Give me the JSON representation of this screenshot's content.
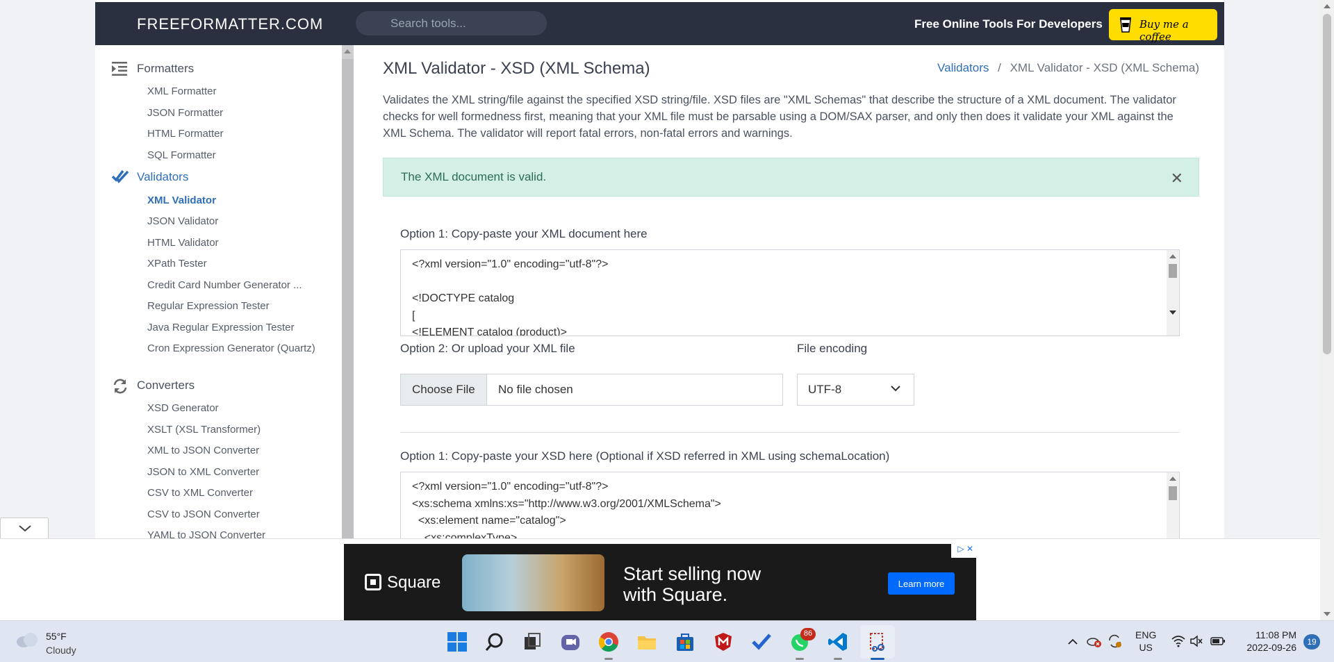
{
  "header": {
    "logo": "FREEFORMATTER.COM",
    "search_placeholder": "Search tools...",
    "tagline": "Free Online Tools For Developers",
    "coffee_label": "Buy me a coffee"
  },
  "sidebar": {
    "sections": [
      {
        "label": "Formatters",
        "icon": "indent-icon",
        "items": [
          "XML Formatter",
          "JSON Formatter",
          "HTML Formatter",
          "SQL Formatter"
        ]
      },
      {
        "label": "Validators",
        "icon": "checkmark-icon",
        "items": [
          "XML Validator",
          "JSON Validator",
          "HTML Validator",
          "XPath Tester",
          "Credit Card Number Generator ...",
          "Regular Expression Tester",
          "Java Regular Expression Tester",
          "Cron Expression Generator (Quartz)"
        ]
      },
      {
        "label": "Converters",
        "icon": "refresh-icon",
        "items": [
          "XSD Generator",
          "XSLT (XSL Transformer)",
          "XML to JSON Converter",
          "JSON to XML Converter",
          "CSV to XML Converter",
          "CSV to JSON Converter",
          "YAML to JSON Converter"
        ]
      }
    ],
    "active_item": "XML Validator"
  },
  "main": {
    "title": "XML Validator - XSD (XML Schema)",
    "breadcrumb": {
      "link": "Validators",
      "separator": "/",
      "current": "XML Validator - XSD (XML Schema)"
    },
    "description": "Validates the XML string/file against the specified XSD string/file. XSD files are \"XML Schemas\" that describe the structure of a XML document. The validator checks for well formedness first, meaning that your XML file must be parsable using a DOM/SAX parser, and only then does it validate your XML against the XML Schema. The validator will report fatal errors, non-fatal errors and warnings.",
    "alert": "The XML document is valid.",
    "xml_option_label": "Option 1: Copy-paste your XML document here",
    "xml_lines": [
      "<?xml version=\"1.0\" encoding=\"utf-8\"?>",
      "",
      "<!DOCTYPE catalog",
      "[",
      "<!ELEMENT catalog (product)>"
    ],
    "upload_label": "Option 2: Or upload your XML file",
    "choose_file": "Choose File",
    "no_file": "No file chosen",
    "encoding_label": "File encoding",
    "encoding_value": "UTF-8",
    "xsd_option_label": "Option 1: Copy-paste your XSD here (Optional if XSD referred in XML using schemaLocation)",
    "xsd_lines": [
      "<?xml version=\"1.0\" encoding=\"utf-8\"?>",
      "<xs:schema xmlns:xs=\"http://www.w3.org/2001/XMLSchema\">",
      "  <xs:element name=\"catalog\">",
      "    <xs:complexType>"
    ]
  },
  "ad": {
    "brand": "Square",
    "headline_1": "Start selling now",
    "headline_2": "with Square.",
    "cta": "Learn more"
  },
  "taskbar": {
    "weather_temp": "55°F",
    "weather_cond": "Cloudy",
    "whatsapp_badge": "86",
    "lang_1": "ENG",
    "lang_2": "US",
    "time": "11:08 PM",
    "date": "2022-09-26",
    "notifications": "19"
  },
  "colors": {
    "header_bg": "#2a3040",
    "accent": "#2f6fb7",
    "alert_bg": "#d4f0e6",
    "coffee_yellow": "#ffdd00"
  }
}
